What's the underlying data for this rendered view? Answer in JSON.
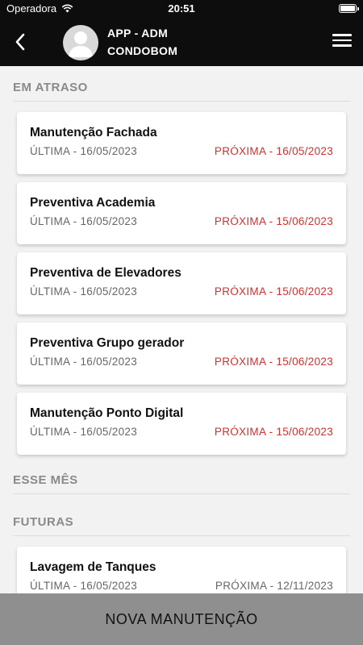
{
  "status_bar": {
    "carrier": "Operadora",
    "time": "20:51",
    "wifi_icon": "wifi-icon",
    "battery_icon": "battery-icon"
  },
  "header": {
    "title": "APP - ADM",
    "subtitle": "CONDOBOM",
    "back_icon": "chevron-left-icon",
    "menu_icon": "hamburger-menu-icon",
    "avatar_icon": "user-avatar-icon"
  },
  "colors": {
    "overdue": "#d32f2f",
    "normal": "#666666",
    "header_bg": "#0d0d0d",
    "footer_bg": "#8f8f8f"
  },
  "sections": {
    "em_atraso": {
      "title": "EM ATRASO",
      "items": [
        {
          "name": "Manutenção Fachada",
          "last": "ÚLTIMA - 16/05/2023",
          "next": "PRÓXIMA - 16/05/2023"
        },
        {
          "name": "Preventiva Academia",
          "last": "ÚLTIMA - 16/05/2023",
          "next": "PRÓXIMA - 15/06/2023"
        },
        {
          "name": "Preventiva de Elevadores",
          "last": "ÚLTIMA - 16/05/2023",
          "next": "PRÓXIMA - 15/06/2023"
        },
        {
          "name": "Preventiva Grupo gerador",
          "last": "ÚLTIMA - 16/05/2023",
          "next": "PRÓXIMA - 15/06/2023"
        },
        {
          "name": "Manutenção Ponto Digital",
          "last": "ÚLTIMA - 16/05/2023",
          "next": "PRÓXIMA - 15/06/2023"
        }
      ]
    },
    "esse_mes": {
      "title": "ESSE MÊS",
      "items": []
    },
    "futuras": {
      "title": "FUTURAS",
      "items": [
        {
          "name": "Lavagem de Tanques",
          "last": "ÚLTIMA - 16/05/2023",
          "next": "PRÓXIMA - 12/11/2023"
        }
      ]
    }
  },
  "footer": {
    "button_label": "NOVA MANUTENÇÃO"
  }
}
